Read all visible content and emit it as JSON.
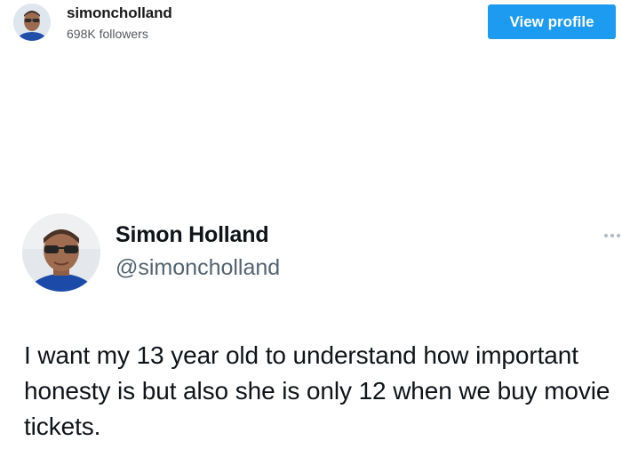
{
  "header": {
    "username": "simoncholland",
    "followers": "698K followers",
    "view_profile_label": "View profile",
    "accent_color": "#1d9bf0"
  },
  "tweet": {
    "author_name": "Simon Holland",
    "author_handle": "@simoncholland",
    "text": "I want my 13 year old to understand how important honesty is but also she is only 12 when we buy movie tickets.",
    "more_icon": "more-horizontal-icon"
  }
}
